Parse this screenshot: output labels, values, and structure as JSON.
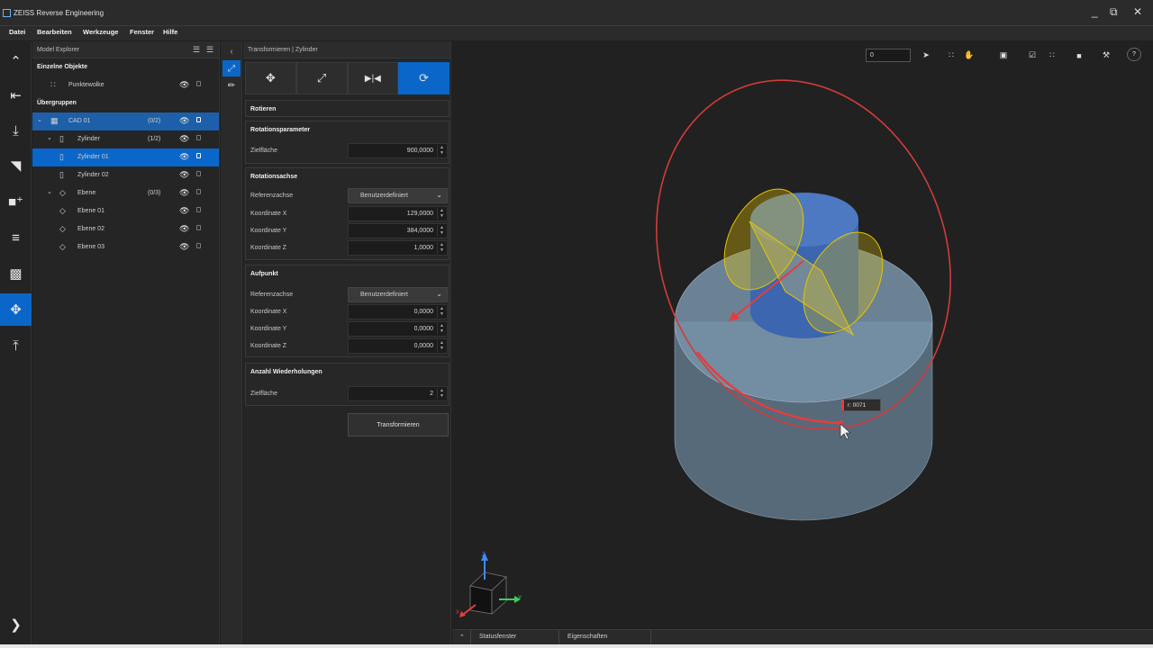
{
  "window": {
    "title": "ZEISS Reverse Engineering",
    "minimize": "_",
    "maximize": "⧉",
    "close": "✕"
  },
  "menu": [
    "Datei",
    "Bearbeiten",
    "Werkzeuge",
    "Fenster",
    "Hilfe"
  ],
  "explorer": {
    "title": "Model Explorer",
    "section_single": "Einzelne Objekte",
    "section_groups": "Übergruppen",
    "items": [
      {
        "label": "Punktewolke",
        "count": ""
      },
      {
        "label": "CAD 01",
        "count": "(0/2)"
      },
      {
        "label": "Zylinder",
        "count": "(1/2)"
      },
      {
        "label": "Zylinder 01",
        "count": ""
      },
      {
        "label": "Zylinder 02",
        "count": ""
      },
      {
        "label": "Ebene",
        "count": "(0/3)"
      },
      {
        "label": "Ebene 01",
        "count": ""
      },
      {
        "label": "Ebene 02",
        "count": ""
      },
      {
        "label": "Ebene 03",
        "count": ""
      }
    ]
  },
  "transform": {
    "title": "Transformieren | Zylinder",
    "mode_title": "Rotieren",
    "rotation_params": {
      "title": "Rotationsparameter",
      "label": "Zielfläche",
      "value": "900,0000"
    },
    "rotation_axis": {
      "title": "Rotationsachse",
      "ref_label": "Referenzachse",
      "ref_value": "Benutzerdefiniert",
      "x_label": "Koordinate X",
      "x_value": "129,0000",
      "y_label": "Koordinate Y",
      "y_value": "384,0000",
      "z_label": "Koordinate Z",
      "z_value": "1,0000"
    },
    "base_point": {
      "title": "Aufpunkt",
      "ref_label": "Referenzachse",
      "ref_value": "Benutzerdefiniert",
      "x_label": "Koordinate X",
      "x_value": "0,0000",
      "y_label": "Koordinate Y",
      "y_value": "0,0000",
      "z_label": "Koordinate Z",
      "z_value": "0,0000"
    },
    "repeat": {
      "title": "Anzahl Wiederholungen",
      "label": "Zielfläche",
      "value": "2"
    },
    "apply_button": "Transformieren"
  },
  "viewport": {
    "input_value": "0",
    "tooltip": "r: 0071",
    "axes": {
      "x": "X",
      "y": "Y",
      "z": "Z"
    },
    "colors": {
      "circle": "#d23b3b",
      "arrow": "#e53d3d",
      "highlight": "#e6c400",
      "base": "#9fb6c9",
      "cylinder": "#3f6bb0"
    }
  },
  "statusbar": {
    "status_tab": "Statusfenster",
    "props_tab": "Eigenschaften"
  },
  "icons": [
    "app-icon",
    "chevron-up-icon",
    "import-icon",
    "download-icon",
    "surface-icon",
    "add-element-icon",
    "align-icon",
    "analysis-icon",
    "transform-icon",
    "export-icon",
    "chevron-right-icon",
    "eye-icon",
    "lock-icon",
    "move-icon",
    "scale-icon",
    "mirror-icon",
    "rotate-icon",
    "brush-icon",
    "collapse-icon",
    "cursor-icon",
    "hand-icon",
    "help-icon"
  ]
}
